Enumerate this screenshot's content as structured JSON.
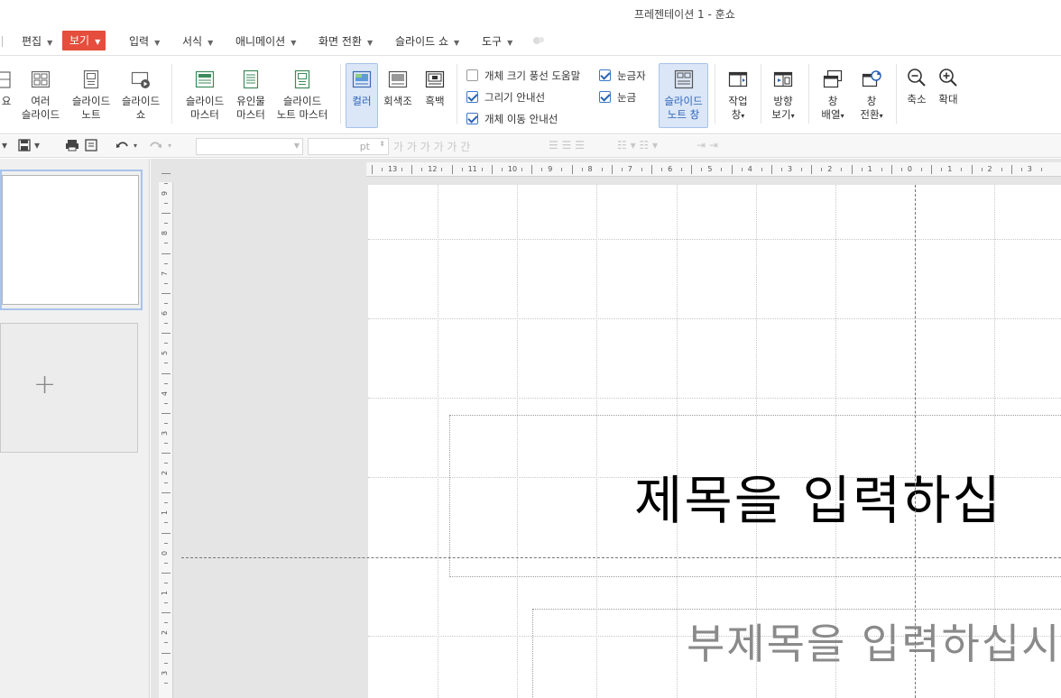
{
  "window": {
    "title": "프레젠테이션 1 - 훈쇼"
  },
  "menu": {
    "items": [
      {
        "label": "편집"
      },
      {
        "label": "보기"
      },
      {
        "label": "입력"
      },
      {
        "label": "서식"
      },
      {
        "label": "애니메이션"
      },
      {
        "label": "화면 전환"
      },
      {
        "label": "슬라이드 쇼"
      },
      {
        "label": "도구"
      }
    ]
  },
  "ribbon": {
    "overview": {
      "label": "요"
    },
    "multi_slide": {
      "line1": "여러",
      "line2": "슬라이드"
    },
    "slide_note": {
      "line1": "슬라이드",
      "line2": "노트"
    },
    "slide_show": {
      "line1": "슬라이드",
      "line2": "쇼"
    },
    "slide_master": {
      "line1": "슬라이드",
      "line2": "마스터"
    },
    "handout_master": {
      "line1": "유인물",
      "line2": "마스터"
    },
    "note_master": {
      "line1": "슬라이드",
      "line2": "노트 마스터"
    },
    "color": {
      "label": "컬러"
    },
    "grayscale": {
      "label": "회색조"
    },
    "bw": {
      "label": "흑백"
    },
    "checks": {
      "balloon": {
        "label": "개체 크기 풍선 도움말",
        "checked": false
      },
      "draw_guide": {
        "label": "그리기 안내선",
        "checked": true
      },
      "move_guide": {
        "label": "개체 이동 안내선",
        "checked": true
      },
      "ruler": {
        "label": "눈금자",
        "checked": true
      },
      "grid": {
        "label": "눈금",
        "checked": true
      }
    },
    "note_window": {
      "line1": "슬라이드",
      "line2": "노트 창"
    },
    "task_pane": {
      "line1": "작업",
      "line2": "창"
    },
    "direction_view": {
      "line1": "방향",
      "line2": "보기"
    },
    "arrange": {
      "line1": "창",
      "line2": "배열"
    },
    "switch": {
      "line1": "창",
      "line2": "전환"
    },
    "zoom_out": {
      "label": "축소"
    },
    "zoom_in": {
      "label": "확대"
    }
  },
  "toolbar": {
    "font_size_unit": "pt",
    "format_glyphs": "가 가 가 가 가 간"
  },
  "hruler_labels": [
    "13",
    "12",
    "11",
    "10",
    "9",
    "8",
    "7",
    "6",
    "5",
    "4",
    "3",
    "2",
    "1",
    "0",
    "1",
    "2",
    "3"
  ],
  "vruler_labels": [
    "9",
    "8",
    "7",
    "6",
    "5",
    "4",
    "3",
    "2",
    "1",
    "0",
    "1",
    "2",
    "3"
  ],
  "slide": {
    "title_placeholder": "제목을 입력하십",
    "subtitle_placeholder": "부제목을 입력하십시"
  },
  "colors": {
    "active_menu": "#e54d3c",
    "active_ribbon": "#dbe6f7",
    "accent_blue": "#2b63b8"
  }
}
